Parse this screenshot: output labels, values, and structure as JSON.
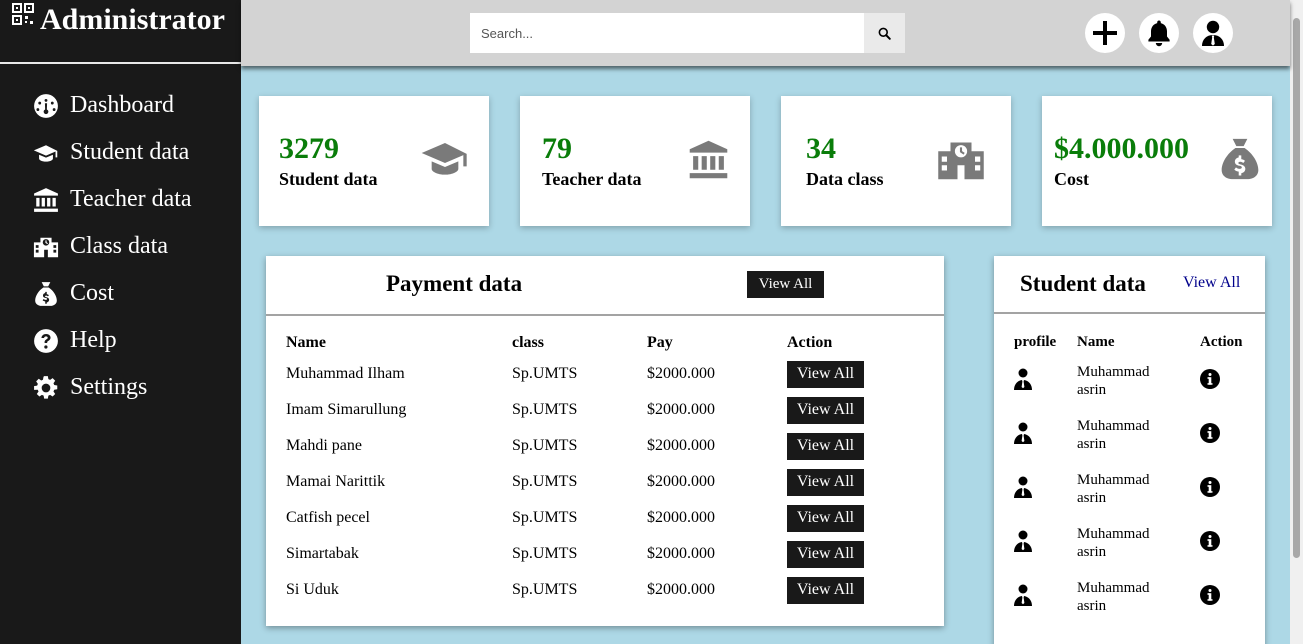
{
  "sidebar": {
    "title": "Administrator",
    "items": [
      {
        "label": "Dashboard",
        "icon": "dashboard-icon"
      },
      {
        "label": "Student data",
        "icon": "graduation-cap-icon"
      },
      {
        "label": "Teacher data",
        "icon": "bank-icon"
      },
      {
        "label": "Class data",
        "icon": "school-icon"
      },
      {
        "label": "Cost",
        "icon": "money-bag-icon"
      },
      {
        "label": "Help",
        "icon": "help-icon"
      },
      {
        "label": "Settings",
        "icon": "gear-icon"
      }
    ]
  },
  "topbar": {
    "search_placeholder": "Search...",
    "icons": [
      "plus-icon",
      "bell-icon",
      "user-icon"
    ]
  },
  "cards": [
    {
      "value": "3279",
      "label": "Student data",
      "icon": "graduation-cap-icon"
    },
    {
      "value": "79",
      "label": "Teacher data",
      "icon": "bank-icon"
    },
    {
      "value": "34",
      "label": "Data class",
      "icon": "school-icon"
    },
    {
      "value": "$4.000.000",
      "label": "Cost",
      "icon": "money-bag-icon"
    }
  ],
  "payment": {
    "title": "Payment data",
    "view_all": "View All",
    "headers": [
      "Name",
      "class",
      "Pay",
      "Action"
    ],
    "rows": [
      {
        "name": "Muhammad Ilham",
        "class": "Sp.UMTS",
        "pay": "$2000.000",
        "action": "View All"
      },
      {
        "name": "Imam Simarullung",
        "class": "Sp.UMTS",
        "pay": "$2000.000",
        "action": "View All"
      },
      {
        "name": "Mahdi pane",
        "class": "Sp.UMTS",
        "pay": "$2000.000",
        "action": "View All"
      },
      {
        "name": "Mamai Narittik",
        "class": "Sp.UMTS",
        "pay": "$2000.000",
        "action": "View All"
      },
      {
        "name": "Catfish pecel",
        "class": "Sp.UMTS",
        "pay": "$2000.000",
        "action": "View All"
      },
      {
        "name": "Simartabak",
        "class": "Sp.UMTS",
        "pay": "$2000.000",
        "action": "View All"
      },
      {
        "name": "Si Uduk",
        "class": "Sp.UMTS",
        "pay": "$2000.000",
        "action": "View All"
      }
    ]
  },
  "students": {
    "title": "Student data",
    "view_all": "View All",
    "headers": [
      "profile",
      "Name",
      "Action"
    ],
    "rows": [
      {
        "name_line1": "Muhammad",
        "name_line2": "asrin"
      },
      {
        "name_line1": "Muhammad",
        "name_line2": "asrin"
      },
      {
        "name_line1": "Muhammad",
        "name_line2": "asrin"
      },
      {
        "name_line1": "Muhammad",
        "name_line2": "asrin"
      },
      {
        "name_line1": "Muhammad",
        "name_line2": "asrin"
      }
    ]
  },
  "colors": {
    "sidebar_bg": "#191919",
    "topbar_bg": "#d3d3d3",
    "content_bg": "#add8e6",
    "card_value": "#0a7d0a",
    "icon_gray": "#7a7a7a",
    "link_blue": "#00008b"
  }
}
